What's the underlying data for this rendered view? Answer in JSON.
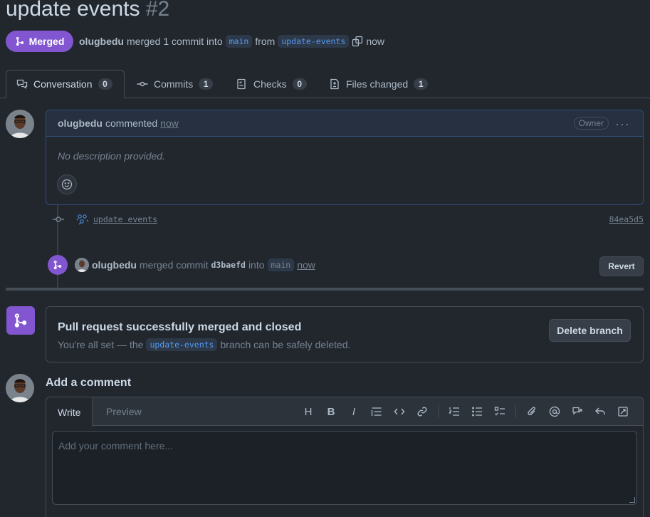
{
  "pr": {
    "title": "update events",
    "number": "#2",
    "state": "Merged",
    "author": "olugbedu",
    "merged_text": "merged 1 commit into",
    "base_branch": "main",
    "from_text": "from",
    "head_branch": "update-events",
    "time": "now"
  },
  "tabs": [
    {
      "label": "Conversation",
      "count": "0"
    },
    {
      "label": "Commits",
      "count": "1"
    },
    {
      "label": "Checks",
      "count": "0"
    },
    {
      "label": "Files changed",
      "count": "1"
    }
  ],
  "comment": {
    "author": "olugbedu",
    "action": "commented",
    "time": "now",
    "badge": "Owner",
    "body": "No description provided."
  },
  "commit": {
    "message": "update events",
    "sha": "84ea5d5"
  },
  "merge_event": {
    "author": "olugbedu",
    "text": "merged commit",
    "sha": "d3baefd",
    "into": "into",
    "branch": "main",
    "time": "now",
    "revert_label": "Revert"
  },
  "merged_box": {
    "heading": "Pull request successfully merged and closed",
    "text_before": "You're all set — the",
    "branch": "update-events",
    "text_after": "branch can be safely deleted.",
    "delete_label": "Delete branch"
  },
  "add_comment": {
    "title": "Add a comment",
    "write_tab": "Write",
    "preview_tab": "Preview",
    "placeholder": "Add your comment here...",
    "toolbar": {
      "heading": "H"
    }
  },
  "colors": {
    "merged_purple": "#8256d0",
    "background": "#22272e",
    "link_blue": "#539bf5"
  }
}
